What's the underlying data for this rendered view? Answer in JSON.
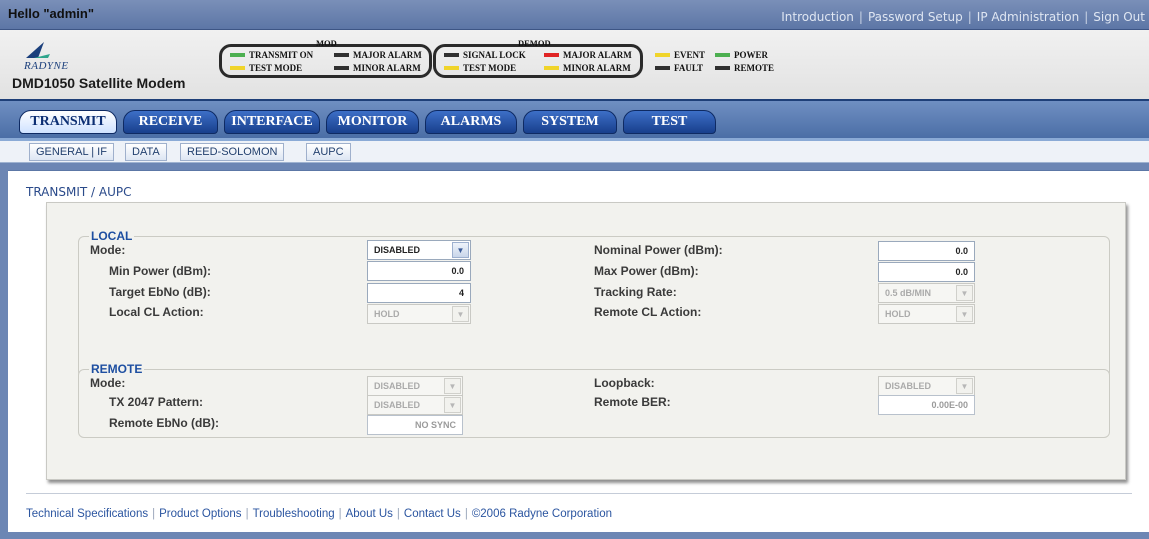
{
  "greeting": "Hello \"admin\"",
  "top_links": [
    "Introduction",
    "Password Setup",
    "IP Administration",
    "Sign Out"
  ],
  "top_link_separator": "|",
  "logo_text": "RADYNE",
  "model_title": "DMD1050 Satellite Modem",
  "status": {
    "mod": {
      "title": "MOD",
      "indicators": [
        {
          "label": "TRANSMIT ON",
          "color": "#4caf50"
        },
        {
          "label": "MAJOR ALARM",
          "color": "#303030"
        },
        {
          "label": "TEST MODE",
          "color": "#f0d42a"
        },
        {
          "label": "MINOR ALARM",
          "color": "#303030"
        }
      ]
    },
    "demod": {
      "title": "DEMOD",
      "indicators": [
        {
          "label": "SIGNAL LOCK",
          "color": "#303030"
        },
        {
          "label": "MAJOR ALARM",
          "color": "#e02424"
        },
        {
          "label": "TEST MODE",
          "color": "#f0d42a"
        },
        {
          "label": "MINOR ALARM",
          "color": "#f0d42a"
        }
      ]
    },
    "other": [
      {
        "label": "EVENT",
        "color": "#f0d42a"
      },
      {
        "label": "POWER",
        "color": "#4caf50"
      },
      {
        "label": "FAULT",
        "color": "#303030"
      },
      {
        "label": "REMOTE",
        "color": "#303030"
      }
    ]
  },
  "nav_tabs": [
    "TRANSMIT",
    "RECEIVE",
    "INTERFACE",
    "MONITOR",
    "ALARMS",
    "SYSTEM",
    "TEST"
  ],
  "active_tab": "TRANSMIT",
  "sub_tabs": [
    "GENERAL | IF",
    "DATA",
    "REED-SOLOMON",
    "AUPC"
  ],
  "breadcrumb": "TRANSMIT / AUPC",
  "local": {
    "legend": "LOCAL",
    "mode_label": "Mode:",
    "mode_value": "DISABLED",
    "min_power_label": "Min Power (dBm):",
    "min_power_value": "0.0",
    "target_ebno_label": "Target EbNo (dB):",
    "target_ebno_value": "4",
    "local_cl_action_label": "Local CL Action:",
    "local_cl_action_value": "HOLD",
    "nominal_power_label": "Nominal Power (dBm):",
    "nominal_power_value": "0.0",
    "max_power_label": "Max Power (dBm):",
    "max_power_value": "0.0",
    "tracking_rate_label": "Tracking Rate:",
    "tracking_rate_value": "0.5 dB/MIN",
    "remote_cl_action_label": "Remote CL Action:",
    "remote_cl_action_value": "HOLD"
  },
  "remote": {
    "legend": "REMOTE",
    "mode_label": "Mode:",
    "mode_value": "DISABLED",
    "tx_pattern_label": "TX 2047 Pattern:",
    "tx_pattern_value": "DISABLED",
    "remote_ebno_label": "Remote EbNo (dB):",
    "remote_ebno_value": "NO SYNC",
    "loopback_label": "Loopback:",
    "loopback_value": "DISABLED",
    "remote_ber_label": "Remote BER:",
    "remote_ber_value": "0.00E-00"
  },
  "footer_links": [
    "Technical Specifications",
    "Product Options",
    "Troubleshooting",
    "About Us",
    "Contact Us",
    "©2006 Radyne Corporation"
  ],
  "footer_separator": "|"
}
